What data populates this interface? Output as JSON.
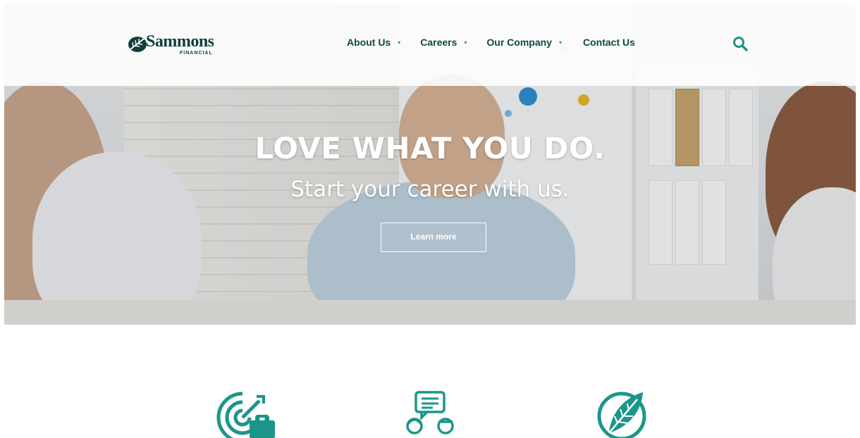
{
  "header": {
    "logo": {
      "brand": "Sammons",
      "sub": "FINANCIAL",
      "icon": "leaf-logo-icon"
    },
    "nav": [
      {
        "label": "About Us",
        "has_dropdown": true
      },
      {
        "label": "Careers",
        "has_dropdown": true
      },
      {
        "label": "Our Company",
        "has_dropdown": true
      },
      {
        "label": "Contact Us",
        "has_dropdown": false
      }
    ],
    "search_icon": "search-icon",
    "dropdown_caret": "▾"
  },
  "hero": {
    "title": "LOVE WHAT YOU DO.",
    "subtitle": "Start your career with us.",
    "button_label": "Learn more"
  },
  "features": [
    {
      "icon": "target-briefcase-icon"
    },
    {
      "icon": "people-conversation-icon"
    },
    {
      "icon": "leaf-badge-icon"
    }
  ],
  "colors": {
    "brand_dark": "#0e3f3b",
    "accent_teal": "#1c968a",
    "nav_text": "#0e4a44"
  }
}
